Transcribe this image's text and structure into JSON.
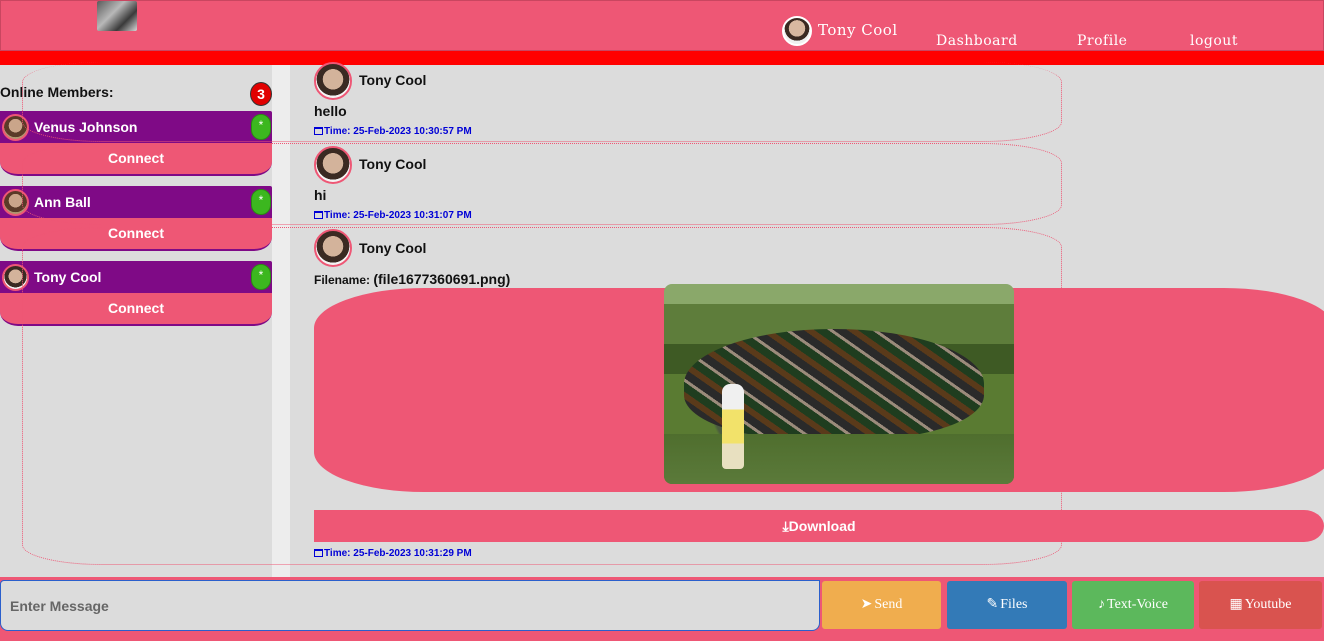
{
  "header": {
    "user_name": "Tony Cool",
    "nav": [
      "Dashboard",
      "Profile",
      "logout"
    ]
  },
  "sidebar": {
    "title": "Online Members:",
    "count": "3",
    "members": [
      {
        "name": "Venus Johnson",
        "status": "*",
        "action": "Connect"
      },
      {
        "name": "Ann Ball",
        "status": "*",
        "action": "Connect"
      },
      {
        "name": "Tony Cool",
        "status": "*",
        "action": "Connect"
      }
    ]
  },
  "messages": [
    {
      "sender": "Tony Cool",
      "text": "hello",
      "time": "Time: 25-Feb-2023 10:30:57 PM"
    },
    {
      "sender": "Tony Cool",
      "text": "hi",
      "time": "Time: 25-Feb-2023 10:31:07 PM"
    },
    {
      "sender": "Tony Cool",
      "file_label": "Filename:",
      "file_name": "(file1677360691.png)",
      "download_label": "Download",
      "time": "Time: 25-Feb-2023 10:31:29 PM"
    }
  ],
  "composer": {
    "placeholder": "Enter Message",
    "buttons": [
      {
        "label": "Send",
        "color": "#f0ad4e",
        "icon": "paper-plane-icon"
      },
      {
        "label": "Files",
        "color": "#337ab7",
        "icon": "paperclip-icon"
      },
      {
        "label": "Text-Voice",
        "color": "#5cb85c",
        "icon": "microphone-icon"
      },
      {
        "label": "Youtube",
        "color": "#d9534f",
        "icon": "film-icon"
      }
    ]
  }
}
